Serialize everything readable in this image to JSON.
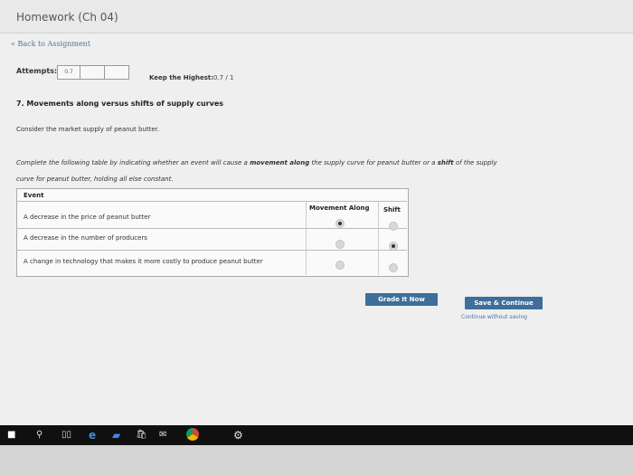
{
  "window": {
    "title": "Homework (Ch 04)"
  },
  "nav": {
    "back_link": "« Back to Assignment"
  },
  "attempts": {
    "label": "Attempts:",
    "value": "0.7"
  },
  "keep": {
    "label": "Keep the Highest:",
    "value": "0.7 / 1"
  },
  "question": {
    "title": "7. Movements along versus shifts of supply curves",
    "consider": "Consider the market supply of peanut butter.",
    "instr_part1": "Complete the following table by indicating whether an event will cause a ",
    "instr_movement": "movement along",
    "instr_part2": " the supply curve for peanut butter or a ",
    "instr_shift": "shift",
    "instr_part3": " of the supply",
    "instr_line2": "curve for peanut butter, holding all else constant."
  },
  "table": {
    "headers": {
      "event": "Event",
      "movement": "Movement Along",
      "shift": "Shift"
    },
    "rows": [
      {
        "event": "A decrease in the price of peanut butter",
        "selected": "movement"
      },
      {
        "event": "A decrease in the number of producers",
        "selected": "shift"
      },
      {
        "event": "A change in technology that makes it more costly to produce peanut butter",
        "selected": "none"
      }
    ]
  },
  "actions": {
    "grade": "Grade It Now",
    "save": "Save & Continue",
    "no_save": "Continue without saving"
  },
  "colors": {
    "button": "#3d6f9a",
    "link": "#5a6fa0"
  },
  "taskbar": {
    "icons": [
      "windows-icon",
      "search-icon",
      "task-view-icon",
      "edge-icon",
      "photos-icon",
      "store-icon",
      "mail-icon",
      "chrome-icon",
      "settings-icon"
    ]
  }
}
